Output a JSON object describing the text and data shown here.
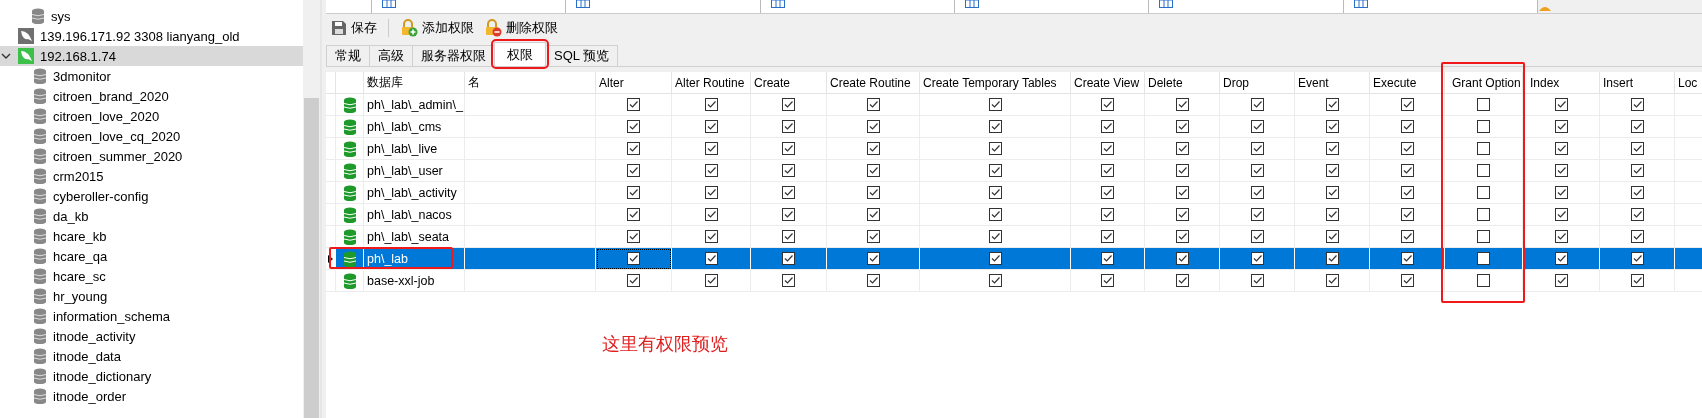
{
  "top_tabs": [
    {
      "kind": "objects"
    },
    {
      "kind": "query"
    },
    {
      "kind": "query"
    },
    {
      "kind": "query"
    },
    {
      "kind": "query"
    },
    {
      "kind": "query"
    },
    {
      "kind": "query"
    }
  ],
  "sidebar": {
    "items": [
      {
        "kind": "database",
        "label": "sys",
        "selected": false
      },
      {
        "kind": "server",
        "label": "139.196.171.92 3308 lianyang_old",
        "connected": false,
        "selected": false
      },
      {
        "kind": "server",
        "label": "192.168.1.74",
        "connected": true,
        "expanded": true,
        "selected": true,
        "children": [
          {
            "kind": "database",
            "label": "3dmonitor",
            "selected": false
          },
          {
            "kind": "database",
            "label": "citroen_brand_2020",
            "selected": false
          },
          {
            "kind": "database",
            "label": "citroen_love_2020",
            "selected": false
          },
          {
            "kind": "database",
            "label": "citroen_love_cq_2020",
            "selected": false
          },
          {
            "kind": "database",
            "label": "citroen_summer_2020",
            "selected": false
          },
          {
            "kind": "database",
            "label": "crm2015",
            "selected": false
          },
          {
            "kind": "database",
            "label": "cyberoller-config",
            "selected": false
          },
          {
            "kind": "database",
            "label": "da_kb",
            "selected": false
          },
          {
            "kind": "database",
            "label": "hcare_kb",
            "selected": false
          },
          {
            "kind": "database",
            "label": "hcare_qa",
            "selected": false
          },
          {
            "kind": "database",
            "label": "hcare_sc",
            "selected": false
          },
          {
            "kind": "database",
            "label": "hr_young",
            "selected": false
          },
          {
            "kind": "database",
            "label": "information_schema",
            "selected": false
          },
          {
            "kind": "database",
            "label": "itnode_activity",
            "selected": false
          },
          {
            "kind": "database",
            "label": "itnode_data",
            "selected": false
          },
          {
            "kind": "database",
            "label": "itnode_dictionary",
            "selected": false
          },
          {
            "kind": "database",
            "label": "itnode_order",
            "selected": false
          }
        ]
      }
    ]
  },
  "toolbar": [
    {
      "kind": "save",
      "label": "保存"
    },
    {
      "kind": "add",
      "label": "添加权限"
    },
    {
      "kind": "remove",
      "label": "删除权限"
    }
  ],
  "tabs": [
    {
      "label": "常规",
      "selected": false,
      "annotated": false
    },
    {
      "label": "高级",
      "selected": false,
      "annotated": false
    },
    {
      "label": "服务器权限",
      "selected": false,
      "annotated": false
    },
    {
      "label": "权限",
      "selected": true,
      "annotated": true
    },
    {
      "label": "SQL 预览",
      "selected": false,
      "annotated": false
    }
  ],
  "table": {
    "columns": [
      {
        "label": "数据库",
        "annotated": false
      },
      {
        "label": "名",
        "annotated": false
      },
      {
        "label": "Alter",
        "annotated": false
      },
      {
        "label": "Alter Routine",
        "annotated": false
      },
      {
        "label": "Create",
        "annotated": false
      },
      {
        "label": "Create Routine",
        "annotated": false
      },
      {
        "label": "Create Temporary Tables",
        "annotated": false
      },
      {
        "label": "Create View",
        "annotated": false
      },
      {
        "label": "Delete",
        "annotated": false
      },
      {
        "label": "Drop",
        "annotated": false
      },
      {
        "label": "Event",
        "annotated": false
      },
      {
        "label": "Execute",
        "annotated": false
      },
      {
        "label": "Grant Option",
        "annotated": true
      },
      {
        "label": "Index",
        "annotated": false
      },
      {
        "label": "Insert",
        "annotated": false
      },
      {
        "label": "Loc",
        "annotated": false
      }
    ],
    "rows": [
      {
        "database": "ph\\_lab\\_admin\\_",
        "selected": false,
        "annotated": false,
        "checks": [
          true,
          true,
          true,
          true,
          true,
          true,
          true,
          true,
          true,
          true,
          false,
          true,
          true
        ]
      },
      {
        "database": "ph\\_lab\\_cms",
        "selected": false,
        "annotated": false,
        "checks": [
          true,
          true,
          true,
          true,
          true,
          true,
          true,
          true,
          true,
          true,
          false,
          true,
          true
        ]
      },
      {
        "database": "ph\\_lab\\_live",
        "selected": false,
        "annotated": false,
        "checks": [
          true,
          true,
          true,
          true,
          true,
          true,
          true,
          true,
          true,
          true,
          false,
          true,
          true
        ]
      },
      {
        "database": "ph\\_lab\\_user",
        "selected": false,
        "annotated": false,
        "checks": [
          true,
          true,
          true,
          true,
          true,
          true,
          true,
          true,
          true,
          true,
          false,
          true,
          true
        ]
      },
      {
        "database": "ph\\_lab\\_activity",
        "selected": false,
        "annotated": false,
        "checks": [
          true,
          true,
          true,
          true,
          true,
          true,
          true,
          true,
          true,
          true,
          false,
          true,
          true
        ]
      },
      {
        "database": "ph\\_lab\\_nacos",
        "selected": false,
        "annotated": false,
        "checks": [
          true,
          true,
          true,
          true,
          true,
          true,
          true,
          true,
          true,
          true,
          false,
          true,
          true
        ]
      },
      {
        "database": "ph\\_lab\\_seata",
        "selected": false,
        "annotated": false,
        "checks": [
          true,
          true,
          true,
          true,
          true,
          true,
          true,
          true,
          true,
          true,
          false,
          true,
          true
        ]
      },
      {
        "database": "ph\\_lab",
        "selected": true,
        "annotated": true,
        "checks": [
          true,
          true,
          true,
          true,
          true,
          true,
          true,
          true,
          true,
          true,
          false,
          true,
          true
        ]
      },
      {
        "database": "base-xxl-job",
        "selected": false,
        "annotated": false,
        "checks": [
          true,
          true,
          true,
          true,
          true,
          true,
          true,
          true,
          true,
          true,
          false,
          true,
          true
        ]
      }
    ]
  },
  "annotation_text": "这里有权限预览"
}
